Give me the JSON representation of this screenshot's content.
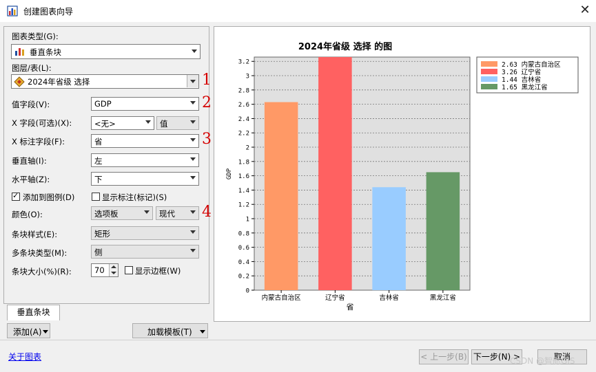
{
  "window": {
    "title": "创建图表向导",
    "close_symbol": "✕"
  },
  "form": {
    "chart_type_label": "图表类型(G):",
    "chart_type_value": "垂直条块",
    "layer_label": "图层/表(L):",
    "layer_value": "2024年省级 选择",
    "value_field_label": "值字段(V):",
    "value_field_value": "GDP",
    "x_field_label": "X 字段(可选)(X):",
    "x_field_value": "<无>",
    "x_field_mode": "值",
    "x_label_field_label": "X 标注字段(F):",
    "x_label_field_value": "省",
    "vaxis_label": "垂直轴(I):",
    "vaxis_value": "左",
    "haxis_label": "水平轴(Z):",
    "haxis_value": "下",
    "add_legend_label": "添加到图例(D)",
    "add_legend_checked": "✓",
    "show_marks_label": "显示标注(标记)(S)",
    "color_label": "颜色(O):",
    "color_value": "选项板",
    "color_scheme": "现代",
    "bar_style_label": "条块样式(E):",
    "bar_style_value": "矩形",
    "multi_bar_label": "多条块类型(M):",
    "multi_bar_value": "侧",
    "bar_size_label": "条块大小(%)(R):",
    "bar_size_value": "70",
    "show_border_label": "显示边框(W)"
  },
  "annotations": [
    "1",
    "2",
    "3",
    "4"
  ],
  "tab_label": "垂直条块",
  "buttons": {
    "add": "添加(A)",
    "load_template": "加载模板(T)",
    "prev": "< 上一步(B)",
    "next": "下一步(N) >",
    "cancel": "取消",
    "about": "关于图表"
  },
  "watermark": "CSDN @智航GIS",
  "colors": {
    "s0": "#ff9966",
    "s1": "#ff6161",
    "s2": "#99ccff",
    "s3": "#669966",
    "plot_bg": "#e0e0e0"
  },
  "chart_data": {
    "type": "bar",
    "title": "2024年省级 选择 的图",
    "xlabel": "省",
    "ylabel": "GDP",
    "categories": [
      "内蒙古自治区",
      "辽宁省",
      "吉林省",
      "黑龙江省"
    ],
    "values": [
      2.63,
      3.26,
      1.44,
      1.65
    ],
    "ylim": [
      0,
      3.26
    ],
    "yticks": [
      "0",
      "0.2",
      "0.4",
      "0.6",
      "0.8",
      "1",
      "1.2",
      "1.4",
      "1.6",
      "1.8",
      "2",
      "2.2",
      "2.4",
      "2.6",
      "2.8",
      "3",
      "3.2"
    ],
    "legend": [
      "2.63 内蒙古自治区",
      "3.26 辽宁省",
      "1.44 吉林省",
      "1.65 黑龙江省"
    ],
    "legend_position": "top-right",
    "grid": true
  }
}
